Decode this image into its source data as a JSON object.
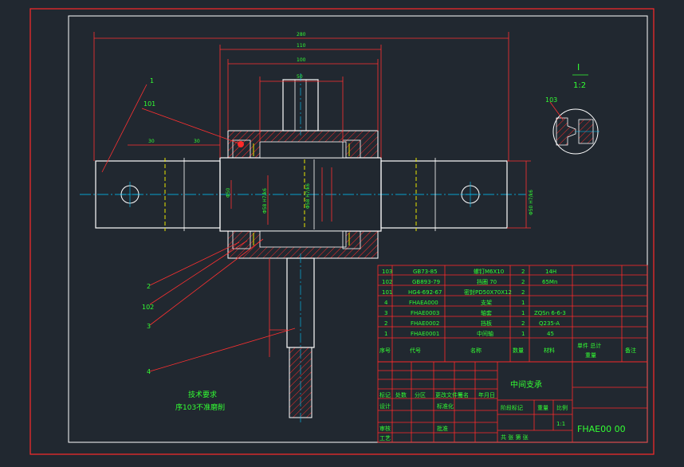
{
  "colors": {
    "background": "#212830",
    "frame": "#ff2a2a",
    "outline": "#ffffff",
    "dimension": "#ff3030",
    "text_green": "#33ff33",
    "centerline": "#00c8ff",
    "yellow": "#e6e600",
    "hatch": "#ff2a2a"
  },
  "dimensions": {
    "overall": "280",
    "inner_110": "110",
    "inner_100": "100",
    "top_50": "50",
    "left_30a": "30",
    "left_30b": "30",
    "bore_left": "Φ50",
    "bore_center": "Φ58 H7/k6",
    "bore_center2": "Φ58 H7/k6",
    "shaft_right": "Φ50 H7/k6"
  },
  "detail": {
    "label": "I",
    "scale": "1:2",
    "callout": "103"
  },
  "balloons": [
    "1",
    "101",
    "2",
    "102",
    "3",
    "4"
  ],
  "notes": {
    "title": "技术要求",
    "line1": "序103不准磨削"
  },
  "parts": [
    {
      "no": "103",
      "code": "GB73-85",
      "name": "螺钉M6X10",
      "qty": "2",
      "material": "14H"
    },
    {
      "no": "102",
      "code": "GB893-79",
      "name": "挡圈 70",
      "qty": "2",
      "material": "65Mn"
    },
    {
      "no": "101",
      "code": "HG4-692-67",
      "name": "密封PD50X70X12",
      "qty": "2",
      "material": ""
    },
    {
      "no": "4",
      "code": "FHAEA000",
      "name": "支架",
      "qty": "1",
      "material": ""
    },
    {
      "no": "3",
      "code": "FHAE0003",
      "name": "轴套",
      "qty": "1",
      "material": "ZQSn 6-6-3"
    },
    {
      "no": "2",
      "code": "FHAE0002",
      "name": "挡板",
      "qty": "2",
      "material": "Q235-A"
    },
    {
      "no": "1",
      "code": "FHAE0001",
      "name": "中间轴",
      "qty": "1",
      "material": "45"
    }
  ],
  "parts_header": {
    "no": "序号",
    "code": "代号",
    "name": "名称",
    "qty": "数量",
    "material": "材料",
    "weight": "单件 总计",
    "weight2": "重量",
    "remark": "备注"
  },
  "title_block": {
    "title": "中间支承",
    "drawing_no": "FHAE00 00",
    "scale": "1:1",
    "stage": "阶段标记",
    "weight": "重量",
    "ratio": "比例",
    "sheets": "共 张 第 张",
    "row_labels": [
      "标记",
      "设计",
      "审核",
      "工艺"
    ],
    "col_labels": [
      "处数",
      "分区",
      "更改文件号",
      "签名",
      "年月日"
    ],
    "std": "标准化",
    "approve": "批准"
  }
}
